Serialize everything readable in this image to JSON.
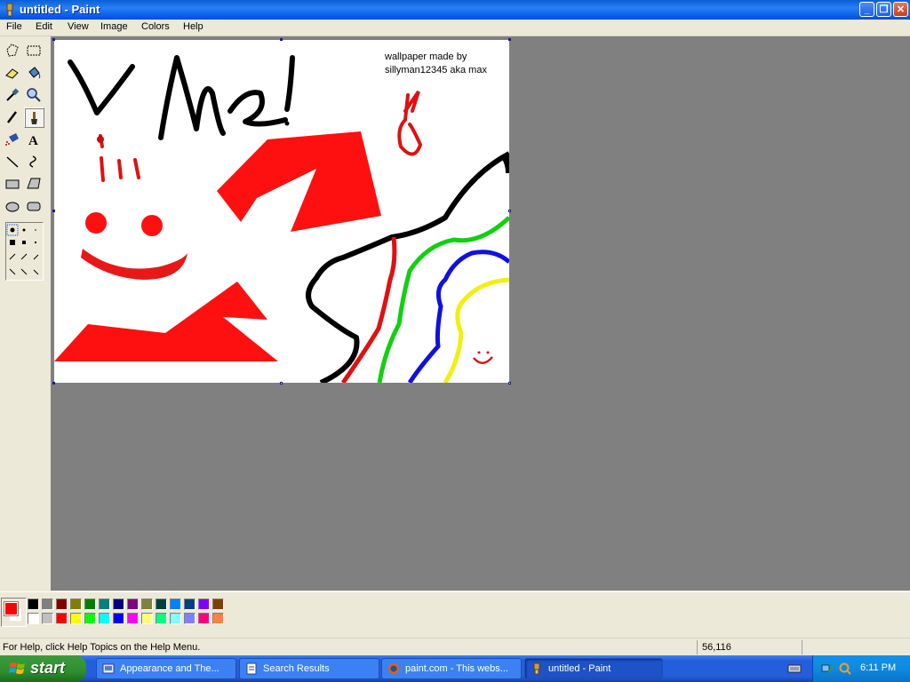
{
  "window": {
    "title": "untitled - Paint"
  },
  "menu": {
    "items": [
      "File",
      "Edit",
      "View",
      "Image",
      "Colors",
      "Help"
    ]
  },
  "toolbox": {
    "tools": [
      "free-form-select",
      "select",
      "eraser",
      "fill-with-color",
      "pick-color",
      "magnifier",
      "pencil",
      "brush",
      "airbrush",
      "text",
      "line",
      "curve",
      "rectangle",
      "polygon",
      "ellipse",
      "rounded-rectangle"
    ],
    "selected": "brush"
  },
  "canvas": {
    "text_line1": "wallpaper made by",
    "text_line2": "sillyman12345 aka max",
    "scribble": "V M2!"
  },
  "palette": {
    "foreground": "#ff0000",
    "background": "#ffffff",
    "colors_top": [
      "#000000",
      "#808080",
      "#800000",
      "#808000",
      "#008000",
      "#008080",
      "#000080",
      "#800080",
      "#808040",
      "#004040",
      "#0080ff",
      "#004080",
      "#8000ff",
      "#804000"
    ],
    "colors_bottom": [
      "#ffffff",
      "#c0c0c0",
      "#ff0000",
      "#ffff00",
      "#00ff00",
      "#00ffff",
      "#0000ff",
      "#ff00ff",
      "#ffff80",
      "#00ff80",
      "#80ffff",
      "#8080ff",
      "#ff0080",
      "#ff8040"
    ]
  },
  "status": {
    "help_text": "For Help, click Help Topics on the Help Menu.",
    "coordinates": "56,116"
  },
  "taskbar": {
    "start_label": "start",
    "tasks": [
      {
        "label": "Appearance and The..."
      },
      {
        "label": "Search Results"
      },
      {
        "label": "paint.com - This webs..."
      },
      {
        "label": "untitled - Paint"
      }
    ],
    "clock": "6:11 PM"
  }
}
